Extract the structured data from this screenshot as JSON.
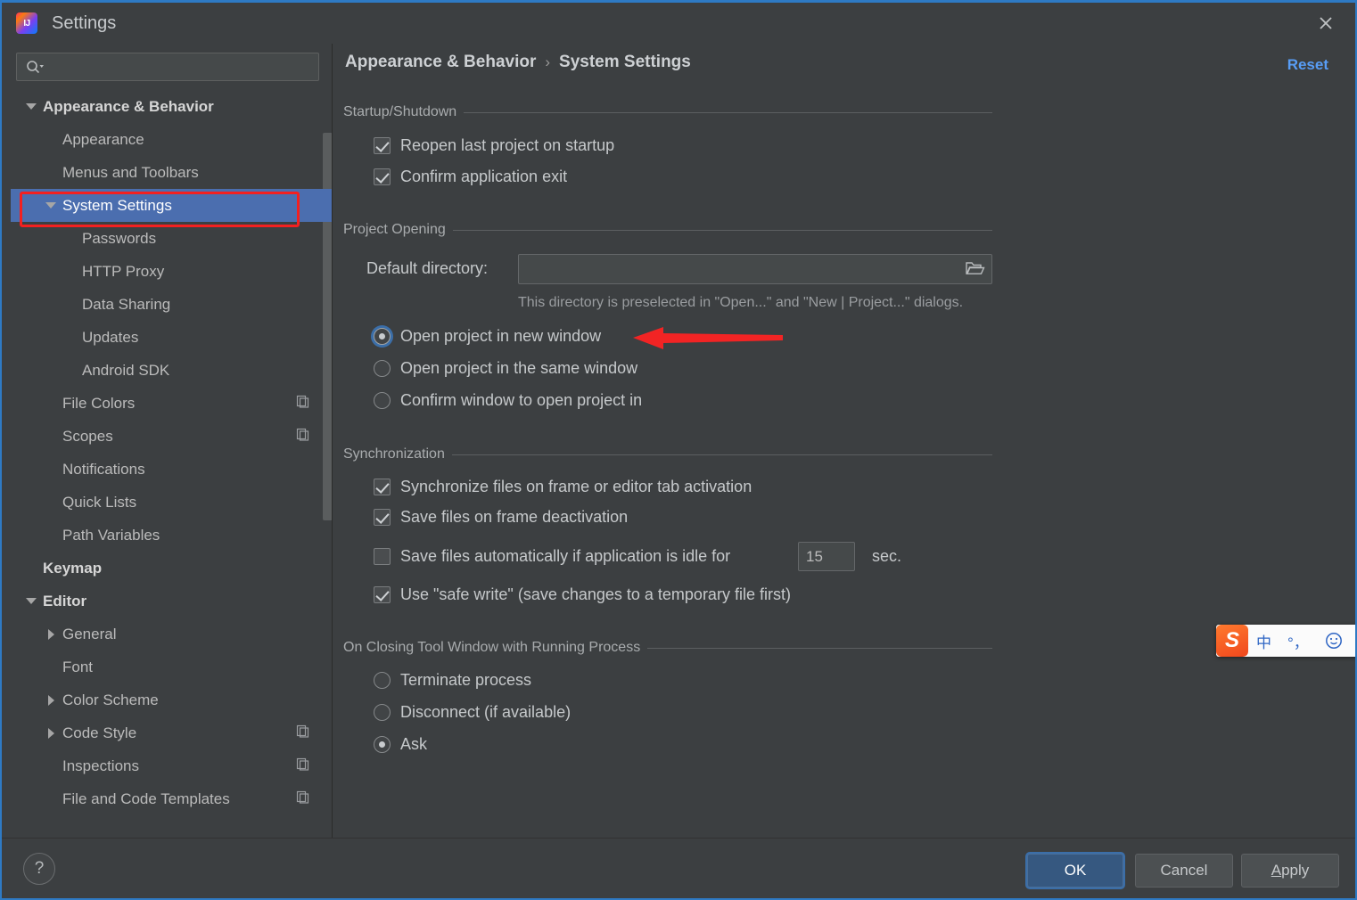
{
  "window": {
    "title": "Settings",
    "logo_icon": "intellij-idea-logo",
    "close_icon": "close-icon"
  },
  "sidebar": {
    "search": {
      "value": "",
      "placeholder": "",
      "icon": "search-icon"
    },
    "items": [
      {
        "label": "Appearance & Behavior",
        "indent": 0,
        "twisty": "down",
        "bold": true,
        "selected": false,
        "copy": false
      },
      {
        "label": "Appearance",
        "indent": 1,
        "twisty": "none",
        "bold": false,
        "selected": false,
        "copy": false
      },
      {
        "label": "Menus and Toolbars",
        "indent": 1,
        "twisty": "none",
        "bold": false,
        "selected": false,
        "copy": false
      },
      {
        "label": "System Settings",
        "indent": 1,
        "twisty": "down",
        "bold": false,
        "selected": true,
        "copy": false
      },
      {
        "label": "Passwords",
        "indent": 2,
        "twisty": "none",
        "bold": false,
        "selected": false,
        "copy": false
      },
      {
        "label": "HTTP Proxy",
        "indent": 2,
        "twisty": "none",
        "bold": false,
        "selected": false,
        "copy": false
      },
      {
        "label": "Data Sharing",
        "indent": 2,
        "twisty": "none",
        "bold": false,
        "selected": false,
        "copy": false
      },
      {
        "label": "Updates",
        "indent": 2,
        "twisty": "none",
        "bold": false,
        "selected": false,
        "copy": false
      },
      {
        "label": "Android SDK",
        "indent": 2,
        "twisty": "none",
        "bold": false,
        "selected": false,
        "copy": false
      },
      {
        "label": "File Colors",
        "indent": 1,
        "twisty": "none",
        "bold": false,
        "selected": false,
        "copy": true
      },
      {
        "label": "Scopes",
        "indent": 1,
        "twisty": "none",
        "bold": false,
        "selected": false,
        "copy": true
      },
      {
        "label": "Notifications",
        "indent": 1,
        "twisty": "none",
        "bold": false,
        "selected": false,
        "copy": false
      },
      {
        "label": "Quick Lists",
        "indent": 1,
        "twisty": "none",
        "bold": false,
        "selected": false,
        "copy": false
      },
      {
        "label": "Path Variables",
        "indent": 1,
        "twisty": "none",
        "bold": false,
        "selected": false,
        "copy": false
      },
      {
        "label": "Keymap",
        "indent": 0,
        "twisty": "none",
        "bold": true,
        "selected": false,
        "copy": false
      },
      {
        "label": "Editor",
        "indent": 0,
        "twisty": "down",
        "bold": true,
        "selected": false,
        "copy": false
      },
      {
        "label": "General",
        "indent": 1,
        "twisty": "right",
        "bold": false,
        "selected": false,
        "copy": false
      },
      {
        "label": "Font",
        "indent": 1,
        "twisty": "none",
        "bold": false,
        "selected": false,
        "copy": false
      },
      {
        "label": "Color Scheme",
        "indent": 1,
        "twisty": "right",
        "bold": false,
        "selected": false,
        "copy": false
      },
      {
        "label": "Code Style",
        "indent": 1,
        "twisty": "right",
        "bold": false,
        "selected": false,
        "copy": true
      },
      {
        "label": "Inspections",
        "indent": 1,
        "twisty": "none",
        "bold": false,
        "selected": false,
        "copy": true
      },
      {
        "label": "File and Code Templates",
        "indent": 1,
        "twisty": "none",
        "bold": false,
        "selected": false,
        "copy": true
      }
    ]
  },
  "main": {
    "breadcrumb": {
      "root": "Appearance & Behavior",
      "separator": "›",
      "current": "System Settings"
    },
    "reset_label": "Reset",
    "sections": {
      "startup": {
        "title": "Startup/Shutdown",
        "checkboxes": [
          {
            "label": "Reopen last project on startup",
            "checked": true
          },
          {
            "label": "Confirm application exit",
            "checked": true
          }
        ]
      },
      "project_opening": {
        "title": "Project Opening",
        "default_directory_label": "Default directory:",
        "default_directory_value": "",
        "browse_icon": "folder-icon",
        "hint": "This directory is preselected in \"Open...\" and \"New | Project...\" dialogs.",
        "radios": [
          {
            "label": "Open project in new window",
            "checked": true,
            "focused": true
          },
          {
            "label": "Open project in the same window",
            "checked": false,
            "focused": false
          },
          {
            "label": "Confirm window to open project in",
            "checked": false,
            "focused": false
          }
        ]
      },
      "synchronization": {
        "title": "Synchronization",
        "checkboxes": [
          {
            "label": "Synchronize files on frame or editor tab activation",
            "checked": true
          },
          {
            "label": "Save files on frame deactivation",
            "checked": true
          },
          {
            "label": "Save files automatically if application is idle for",
            "checked": false
          },
          {
            "label": "Use \"safe write\" (save changes to a temporary file first)",
            "checked": true
          }
        ],
        "idle_value": "15",
        "idle_unit": "sec."
      },
      "closing_tool_window": {
        "title": "On Closing Tool Window with Running Process",
        "radios": [
          {
            "label": "Terminate process",
            "checked": false
          },
          {
            "label": "Disconnect (if available)",
            "checked": false
          },
          {
            "label": "Ask",
            "checked": true
          }
        ]
      }
    }
  },
  "footer": {
    "help_label": "?",
    "ok_label": "OK",
    "cancel_label": "Cancel",
    "apply_label_first": "A",
    "apply_label_rest": "pply"
  },
  "ime_toolbar": {
    "logo_label": "S",
    "items": [
      {
        "label": "中",
        "name": "language-mode-chinese"
      },
      {
        "label": "°，",
        "name": "punctuation-mode"
      },
      {
        "label": "☺",
        "name": "emoji-icon"
      },
      {
        "label": "⬤",
        "name": "microphone-icon"
      }
    ]
  },
  "colors": {
    "accent": "#4b6eaf",
    "link": "#589df6",
    "annotation": "#f22020",
    "background": "#3c3f41",
    "primary_button": "#365880",
    "window_border": "#2e7ac4"
  }
}
